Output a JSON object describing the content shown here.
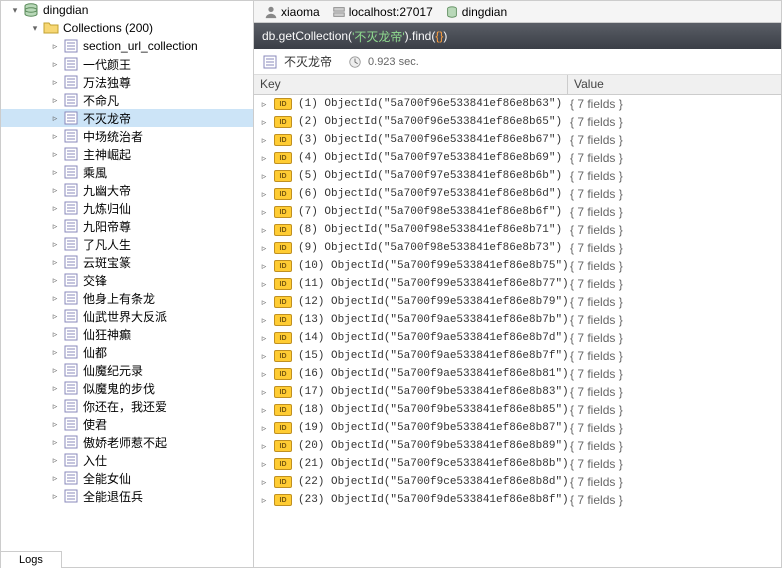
{
  "sidebar": {
    "db_name": "dingdian",
    "collections_label": "Collections (200)",
    "items": [
      "section_url_collection",
      "一代颜王",
      "万法独尊",
      "不命凡",
      "不灭龙帝",
      "中场统治者",
      "主神崛起",
      "乘風",
      "九幽大帝",
      "九炼归仙",
      "九阳帝尊",
      "了凡人生",
      "云斑宝篆",
      "交锋",
      "他身上有条龙",
      "仙武世界大反派",
      "仙狂神癫",
      "仙都",
      "仙魔纪元录",
      "似魔鬼的步伐",
      "你还在，我还爱",
      "使君",
      "傲娇老师惹不起",
      "入仕",
      "全能女仙",
      "全能退伍兵"
    ],
    "selected_index": 4
  },
  "conn": {
    "user": "xiaoma",
    "host": "localhost:27017",
    "db": "dingdian"
  },
  "query": {
    "prefix": "db.getCollection(",
    "collection": "'不灭龙帝'",
    "mid": ").find(",
    "braces": "{}",
    "suffix": ")"
  },
  "status": {
    "collection_name": "不灭龙帝",
    "timing": "0.923 sec."
  },
  "columns": {
    "key": "Key",
    "value": "Value"
  },
  "rows": [
    {
      "idx": "(1)",
      "id": "ObjectId(\"5a700f96e533841ef86e8b63\")",
      "val": "{ 7 fields }"
    },
    {
      "idx": "(2)",
      "id": "ObjectId(\"5a700f96e533841ef86e8b65\")",
      "val": "{ 7 fields }"
    },
    {
      "idx": "(3)",
      "id": "ObjectId(\"5a700f96e533841ef86e8b67\")",
      "val": "{ 7 fields }"
    },
    {
      "idx": "(4)",
      "id": "ObjectId(\"5a700f97e533841ef86e8b69\")",
      "val": "{ 7 fields }"
    },
    {
      "idx": "(5)",
      "id": "ObjectId(\"5a700f97e533841ef86e8b6b\")",
      "val": "{ 7 fields }"
    },
    {
      "idx": "(6)",
      "id": "ObjectId(\"5a700f97e533841ef86e8b6d\")",
      "val": "{ 7 fields }"
    },
    {
      "idx": "(7)",
      "id": "ObjectId(\"5a700f98e533841ef86e8b6f\")",
      "val": "{ 7 fields }"
    },
    {
      "idx": "(8)",
      "id": "ObjectId(\"5a700f98e533841ef86e8b71\")",
      "val": "{ 7 fields }"
    },
    {
      "idx": "(9)",
      "id": "ObjectId(\"5a700f98e533841ef86e8b73\")",
      "val": "{ 7 fields }"
    },
    {
      "idx": "(10)",
      "id": "ObjectId(\"5a700f99e533841ef86e8b75\")",
      "val": "{ 7 fields }"
    },
    {
      "idx": "(11)",
      "id": "ObjectId(\"5a700f99e533841ef86e8b77\")",
      "val": "{ 7 fields }"
    },
    {
      "idx": "(12)",
      "id": "ObjectId(\"5a700f99e533841ef86e8b79\")",
      "val": "{ 7 fields }"
    },
    {
      "idx": "(13)",
      "id": "ObjectId(\"5a700f9ae533841ef86e8b7b\")",
      "val": "{ 7 fields }"
    },
    {
      "idx": "(14)",
      "id": "ObjectId(\"5a700f9ae533841ef86e8b7d\")",
      "val": "{ 7 fields }"
    },
    {
      "idx": "(15)",
      "id": "ObjectId(\"5a700f9ae533841ef86e8b7f\")",
      "val": "{ 7 fields }"
    },
    {
      "idx": "(16)",
      "id": "ObjectId(\"5a700f9ae533841ef86e8b81\")",
      "val": "{ 7 fields }"
    },
    {
      "idx": "(17)",
      "id": "ObjectId(\"5a700f9be533841ef86e8b83\")",
      "val": "{ 7 fields }"
    },
    {
      "idx": "(18)",
      "id": "ObjectId(\"5a700f9be533841ef86e8b85\")",
      "val": "{ 7 fields }"
    },
    {
      "idx": "(19)",
      "id": "ObjectId(\"5a700f9be533841ef86e8b87\")",
      "val": "{ 7 fields }"
    },
    {
      "idx": "(20)",
      "id": "ObjectId(\"5a700f9be533841ef86e8b89\")",
      "val": "{ 7 fields }"
    },
    {
      "idx": "(21)",
      "id": "ObjectId(\"5a700f9ce533841ef86e8b8b\")",
      "val": "{ 7 fields }"
    },
    {
      "idx": "(22)",
      "id": "ObjectId(\"5a700f9ce533841ef86e8b8d\")",
      "val": "{ 7 fields }"
    },
    {
      "idx": "(23)",
      "id": "ObjectId(\"5a700f9de533841ef86e8b8f\")",
      "val": "{ 7 fields }"
    }
  ],
  "logs_tab": "Logs"
}
